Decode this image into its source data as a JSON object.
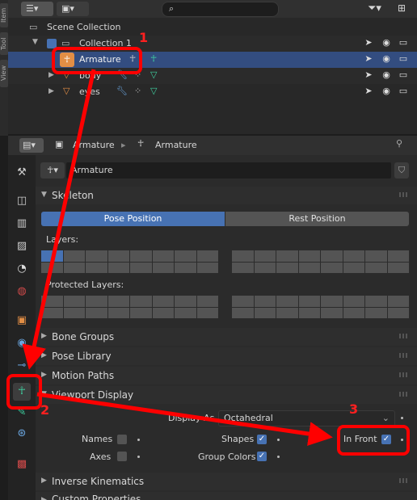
{
  "vertical_tabs": [
    "Item",
    "Tool",
    "View"
  ],
  "outliner": {
    "scene_collection": "Scene Collection",
    "collection": "Collection 1",
    "items": [
      {
        "label": "Armature",
        "selected": true
      },
      {
        "label": "body",
        "selected": false
      },
      {
        "label": "eyes",
        "selected": false
      }
    ]
  },
  "properties": {
    "breadcrumb_object": "Armature",
    "breadcrumb_data": "Armature",
    "datablock_name": "Armature",
    "skeleton": {
      "title": "Skeleton",
      "pose_position": "Pose Position",
      "rest_position": "Rest Position",
      "layers_label": "Layers:",
      "protected_layers_label": "Protected Layers:"
    },
    "panels": {
      "bone_groups": "Bone Groups",
      "pose_library": "Pose Library",
      "motion_paths": "Motion Paths",
      "viewport_display": "Viewport Display",
      "inverse_kinematics": "Inverse Kinematics",
      "custom_properties": "Custom Properties"
    },
    "viewport_display": {
      "display_as_label": "Display As",
      "display_as_value": "Octahedral",
      "names": "Names",
      "axes": "Axes",
      "shapes": "Shapes",
      "group_colors": "Group Colors",
      "in_front": "In Front",
      "names_checked": false,
      "axes_checked": false,
      "shapes_checked": true,
      "group_colors_checked": true,
      "in_front_checked": true
    }
  },
  "annotations": {
    "step1": "1",
    "step2": "2",
    "step3": "3"
  },
  "colors": {
    "accent": "#4772b3",
    "selection": "#334d80",
    "annotation": "#ff0000"
  }
}
